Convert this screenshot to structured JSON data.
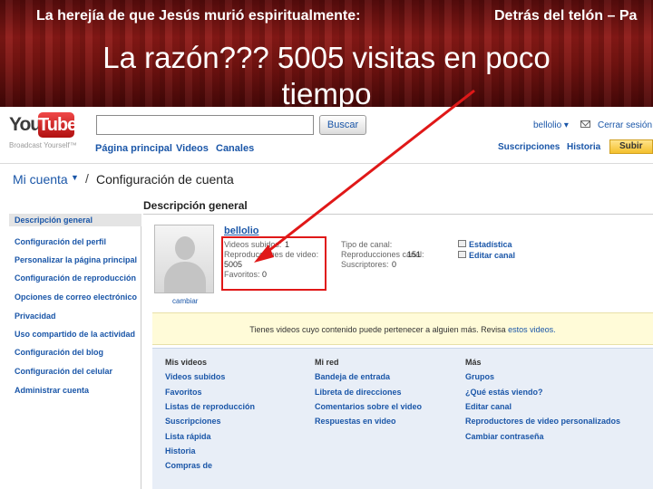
{
  "slide": {
    "header_left": "La herejía de que Jesús murió espiritualmente:",
    "header_right": "Detrás del telón – Pa",
    "title": "La razón??? 5005 visitas en poco tiempo"
  },
  "youtube": {
    "logo_you": "You",
    "logo_tube": "Tube",
    "tagline": "Broadcast Yourself™",
    "search": {
      "value": "",
      "button": "Buscar"
    },
    "nav": [
      "Página principal",
      "Videos",
      "Canales"
    ],
    "user_menu": "bellolio ▾",
    "signout": "Cerrar sesión",
    "top_links": [
      "Suscripciones",
      "Historia"
    ],
    "upload": "Subir",
    "breadcrumb": {
      "account": "Mi cuenta",
      "caret": "▼",
      "sep": "/",
      "title": "Configuración de cuenta"
    },
    "sidebar": [
      "Descripción general",
      "Configuración del perfil",
      "Personalizar la página principal",
      "Configuración de reproducción",
      "Opciones de correo electrónico",
      "Privacidad",
      "Uso compartido de la actividad",
      "Configuración del blog",
      "Configuración del celular",
      "Administrar cuenta"
    ],
    "main_title": "Descripción general",
    "profile": {
      "username": "bellolio",
      "change": "cambiar",
      "stats_left": [
        {
          "label": "Videos subidos:",
          "value": "1"
        },
        {
          "label": "Reproducciones de video:",
          "value": ""
        },
        {
          "label": "5005",
          "value": ""
        },
        {
          "label": "Favoritos:",
          "value": "0"
        }
      ],
      "stats_mid": [
        {
          "label": "Tipo de canal:",
          "value": ""
        },
        {
          "label": "Reproducciones canal:",
          "value": "151"
        },
        {
          "label": "Suscriptores:",
          "value": "0"
        }
      ],
      "stats_right": [
        "Estadística",
        "Editar canal"
      ]
    },
    "notice": {
      "text": "Tienes videos cuyo contenido puede pertenecer a alguien más. Revisa",
      "link": "estos videos."
    },
    "columns": [
      {
        "head": "Mis videos",
        "links": [
          "Videos subidos",
          "Favoritos",
          "Listas de reproducción",
          "Suscripciones",
          "Lista rápida",
          "Historia",
          "Compras de"
        ]
      },
      {
        "head": "Mi red",
        "links": [
          "Bandeja de entrada",
          "Libreta de direcciones",
          "Comentarios sobre el video",
          "Respuestas en video"
        ]
      },
      {
        "head": "Más",
        "links": [
          "Grupos",
          "¿Qué estás viendo?",
          "Editar canal",
          "Reproductores de video personalizados",
          "Cambiar contraseña"
        ]
      }
    ]
  },
  "colors": {
    "accent": "#1a56a8",
    "arrow": "#e01818",
    "slide_bg": "#7a1411"
  }
}
